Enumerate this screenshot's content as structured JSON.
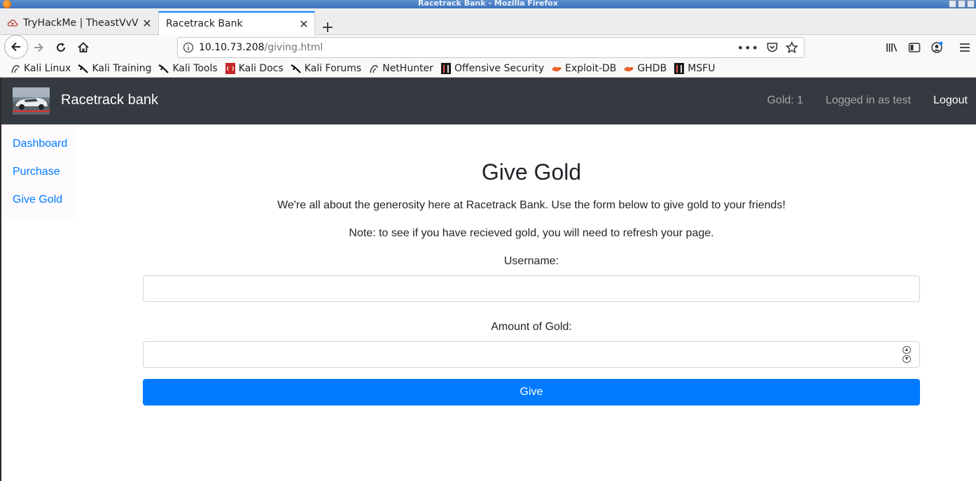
{
  "window": {
    "title": "Racetrack Bank - Mozilla Firefox"
  },
  "tabs": [
    {
      "label": "TryHackMe | TheastVvV",
      "icon": "tryhackme-cloud-icon",
      "active": false
    },
    {
      "label": "Racetrack Bank",
      "active": true
    }
  ],
  "urlbar": {
    "host": "10.10.73.208",
    "path": "/giving.html"
  },
  "bookmarks": [
    {
      "label": "Kali Linux",
      "icon": "kali-dragon-icon"
    },
    {
      "label": "Kali Training",
      "icon": "kali-icon"
    },
    {
      "label": "Kali Tools",
      "icon": "kali-icon"
    },
    {
      "label": "Kali Docs",
      "icon": "docs-red-icon"
    },
    {
      "label": "Kali Forums",
      "icon": "kali-icon"
    },
    {
      "label": "NetHunter",
      "icon": "kali-dragon-icon"
    },
    {
      "label": "Offensive Security",
      "icon": "offsec-icon"
    },
    {
      "label": "Exploit-DB",
      "icon": "exploitdb-icon"
    },
    {
      "label": "GHDB",
      "icon": "exploitdb-icon"
    },
    {
      "label": "MSFU",
      "icon": "offsec-icon"
    }
  ],
  "site": {
    "brand": "Racetrack bank",
    "gold": "Gold: 1",
    "logged_in": "Logged in as test",
    "logout": "Logout"
  },
  "sidebar": {
    "items": [
      {
        "label": "Dashboard"
      },
      {
        "label": "Purchase"
      },
      {
        "label": "Give Gold"
      }
    ]
  },
  "main": {
    "title": "Give Gold",
    "intro": "We're all about the generosity here at Racetrack Bank. Use the form below to give gold to your friends!",
    "note": "Note: to see if you have recieved gold, you will need to refresh your page.",
    "username_label": "Username:",
    "username_value": "",
    "amount_label": "Amount of Gold:",
    "amount_value": "",
    "submit_label": "Give"
  },
  "colors": {
    "accent": "#007bff",
    "navbar": "#343a40",
    "firefox_tab_accent": "#0a84ff"
  }
}
